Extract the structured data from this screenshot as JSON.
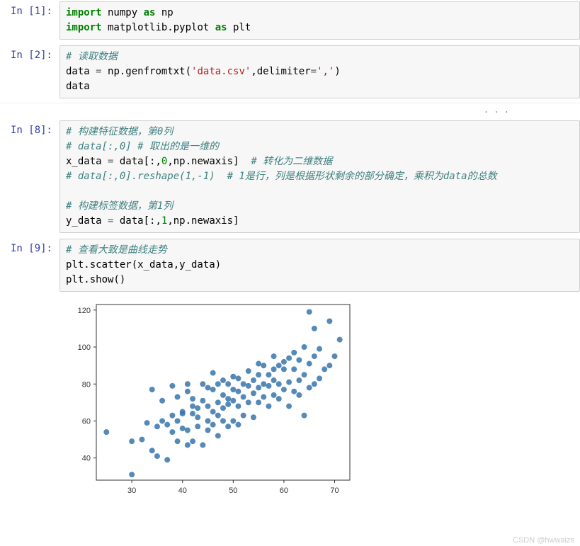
{
  "cells": [
    {
      "prompt": "In  [1]:",
      "code": [
        [
          [
            "kw",
            "import"
          ],
          [
            "nm",
            " numpy "
          ],
          [
            "kw",
            "as"
          ],
          [
            "nm",
            " np"
          ]
        ],
        [
          [
            "kw",
            "import"
          ],
          [
            "nm",
            " matplotlib.pyplot "
          ],
          [
            "kw",
            "as"
          ],
          [
            "nm",
            " plt"
          ]
        ]
      ]
    },
    {
      "prompt": "In  [2]:",
      "code": [
        [
          [
            "cm",
            "# 读取数据"
          ]
        ],
        [
          [
            "nm",
            "data "
          ],
          [
            "op",
            "="
          ],
          [
            "nm",
            " np.genfromtxt("
          ],
          [
            "str",
            "'data.csv'"
          ],
          [
            "nm",
            ",delimiter"
          ],
          [
            "op",
            "="
          ],
          [
            "str",
            "','"
          ],
          [
            "nm",
            ")"
          ]
        ],
        [
          [
            "nm",
            "data"
          ]
        ]
      ]
    },
    {
      "prompt": "In  [8]:",
      "code": [
        [
          [
            "cm",
            "# 构建特征数据，第0列"
          ]
        ],
        [
          [
            "cm",
            "# data[:,0] # 取出的是一维的"
          ]
        ],
        [
          [
            "nm",
            "x_data "
          ],
          [
            "op",
            "="
          ],
          [
            "nm",
            " data[:,"
          ],
          [
            "num",
            "0"
          ],
          [
            "nm",
            ",np.newaxis]  "
          ],
          [
            "cm",
            "# 转化为二维数据"
          ]
        ],
        [
          [
            "cm",
            "# data[:,0].reshape(1,-1)  # 1是行，列是根据形状剩余的部分确定，乘积为data的总数"
          ]
        ],
        [
          [
            "nm",
            ""
          ]
        ],
        [
          [
            "cm",
            "# 构建标签数据，第1列"
          ]
        ],
        [
          [
            "nm",
            "y_data "
          ],
          [
            "op",
            "="
          ],
          [
            "nm",
            " data[:,"
          ],
          [
            "num",
            "1"
          ],
          [
            "nm",
            ",np.newaxis]"
          ]
        ]
      ]
    },
    {
      "prompt": "In  [9]:",
      "code": [
        [
          [
            "cm",
            "# 查看大致是曲线走势"
          ]
        ],
        [
          [
            "nm",
            "plt.scatter(x_data,y_data)"
          ]
        ],
        [
          [
            "nm",
            "plt.show()"
          ]
        ]
      ],
      "has_output": true
    }
  ],
  "ellipsis": ". . .",
  "watermark": "CSDN @hwwaizs",
  "chart_data": {
    "type": "scatter",
    "xlabel": "",
    "ylabel": "",
    "xlim": [
      23,
      73
    ],
    "ylim": [
      28,
      123
    ],
    "xticks": [
      30,
      40,
      50,
      60,
      70
    ],
    "yticks": [
      40,
      60,
      80,
      100,
      120
    ],
    "color": "#3776ab",
    "points": [
      [
        25,
        54
      ],
      [
        30,
        31
      ],
      [
        30,
        49
      ],
      [
        32,
        50
      ],
      [
        33,
        59
      ],
      [
        34,
        44
      ],
      [
        34,
        77
      ],
      [
        35,
        41
      ],
      [
        35,
        57
      ],
      [
        36,
        60
      ],
      [
        36,
        71
      ],
      [
        37,
        39
      ],
      [
        37,
        58
      ],
      [
        38,
        54
      ],
      [
        38,
        63
      ],
      [
        38,
        79
      ],
      [
        39,
        49
      ],
      [
        39,
        60
      ],
      [
        39,
        73
      ],
      [
        40,
        56
      ],
      [
        40,
        64
      ],
      [
        40,
        65
      ],
      [
        41,
        47
      ],
      [
        41,
        55
      ],
      [
        41,
        76
      ],
      [
        41,
        80
      ],
      [
        42,
        49
      ],
      [
        42,
        64
      ],
      [
        42,
        68
      ],
      [
        42,
        72
      ],
      [
        43,
        57
      ],
      [
        43,
        62
      ],
      [
        43,
        67
      ],
      [
        44,
        47
      ],
      [
        44,
        71
      ],
      [
        44,
        80
      ],
      [
        45,
        55
      ],
      [
        45,
        60
      ],
      [
        45,
        68
      ],
      [
        45,
        78
      ],
      [
        46,
        58
      ],
      [
        46,
        65
      ],
      [
        46,
        77
      ],
      [
        46,
        86
      ],
      [
        47,
        52
      ],
      [
        47,
        63
      ],
      [
        47,
        70
      ],
      [
        47,
        80
      ],
      [
        48,
        60
      ],
      [
        48,
        67
      ],
      [
        48,
        74
      ],
      [
        48,
        82
      ],
      [
        49,
        57
      ],
      [
        49,
        69
      ],
      [
        49,
        72
      ],
      [
        49,
        80
      ],
      [
        50,
        60
      ],
      [
        50,
        71
      ],
      [
        50,
        77
      ],
      [
        50,
        84
      ],
      [
        51,
        58
      ],
      [
        51,
        68
      ],
      [
        51,
        76
      ],
      [
        51,
        83
      ],
      [
        52,
        63
      ],
      [
        52,
        73
      ],
      [
        52,
        80
      ],
      [
        53,
        70
      ],
      [
        53,
        79
      ],
      [
        53,
        87
      ],
      [
        54,
        62
      ],
      [
        54,
        75
      ],
      [
        54,
        82
      ],
      [
        55,
        70
      ],
      [
        55,
        78
      ],
      [
        55,
        85
      ],
      [
        55,
        91
      ],
      [
        56,
        73
      ],
      [
        56,
        80
      ],
      [
        56,
        90
      ],
      [
        57,
        68
      ],
      [
        57,
        79
      ],
      [
        57,
        85
      ],
      [
        58,
        74
      ],
      [
        58,
        82
      ],
      [
        58,
        88
      ],
      [
        58,
        95
      ],
      [
        59,
        72
      ],
      [
        59,
        80
      ],
      [
        59,
        90
      ],
      [
        60,
        77
      ],
      [
        60,
        88
      ],
      [
        60,
        92
      ],
      [
        61,
        68
      ],
      [
        61,
        81
      ],
      [
        61,
        94
      ],
      [
        62,
        76
      ],
      [
        62,
        88
      ],
      [
        62,
        97
      ],
      [
        63,
        74
      ],
      [
        63,
        82
      ],
      [
        63,
        93
      ],
      [
        64,
        63
      ],
      [
        64,
        85
      ],
      [
        64,
        100
      ],
      [
        65,
        78
      ],
      [
        65,
        91
      ],
      [
        65,
        119
      ],
      [
        66,
        80
      ],
      [
        66,
        95
      ],
      [
        66,
        110
      ],
      [
        67,
        83
      ],
      [
        67,
        99
      ],
      [
        68,
        88
      ],
      [
        69,
        90
      ],
      [
        69,
        114
      ],
      [
        70,
        95
      ],
      [
        71,
        104
      ]
    ]
  }
}
